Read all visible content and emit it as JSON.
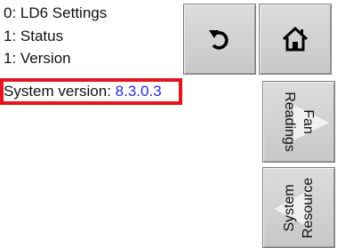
{
  "breadcrumb": {
    "items": [
      "0: LD6 Settings",
      "1: Status",
      "1: Version"
    ]
  },
  "system_version": {
    "label": "System version:",
    "value": "8.3.0.3"
  },
  "buttons": {
    "back_icon": "undo-arrow-icon",
    "home_icon": "home-icon",
    "fan_readings": {
      "line1": "Fan",
      "line2": "Readings"
    },
    "system_resource": {
      "line1": "System",
      "line2": "Resource"
    }
  },
  "colors": {
    "highlight_border": "#e8141b",
    "version_value": "#2a2bd6",
    "button_face": "#d2d2d2"
  }
}
